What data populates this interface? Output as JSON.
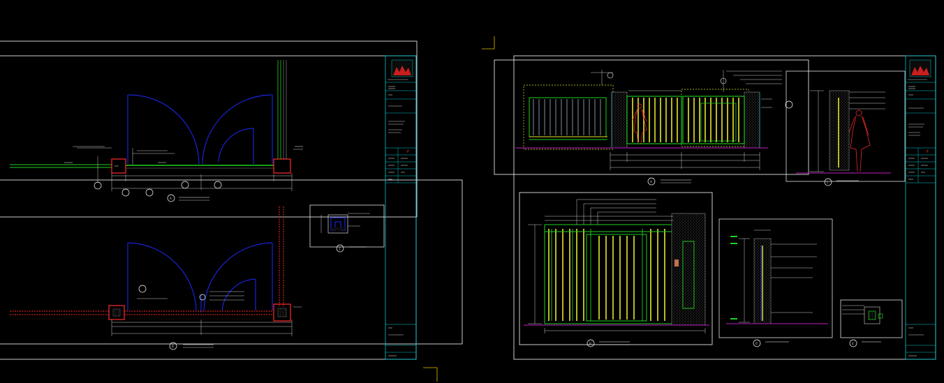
{
  "colors": {
    "background": "#000000",
    "sheet_border": "#ffffff",
    "title_block": "#00c8d0",
    "door_arc": "#1a2cff",
    "wall_green": "#1ed21e",
    "gate_yellow": "#e8e82a",
    "post_red": "#ff2a2a",
    "figure_red": "#ff3030",
    "floor_magenta": "#c020c0",
    "hatch_gray": "#9a9a9a",
    "logo_red": "#c81e1e",
    "corner_mark": "#e8c200"
  },
  "left_sheet": {
    "title_block": {
      "revision_mark": "F",
      "rows": [
        "",
        "",
        "",
        "",
        "",
        "",
        "",
        "",
        ""
      ]
    },
    "view_a": {
      "bubble": "A"
    },
    "view_b": {
      "bubble": "B"
    },
    "detail_1": {
      "bubble": "1"
    }
  },
  "right_sheet": {
    "title_block": {
      "revision_mark": "F",
      "rows": [
        "",
        "",
        "",
        "",
        "",
        "",
        "",
        "",
        ""
      ]
    },
    "elevation_a": {
      "bubble": "A"
    },
    "section_c": {
      "bubble": "C"
    },
    "elevation_b": {
      "bubble": "B"
    },
    "section_d": {
      "bubble": "D"
    },
    "detail_e": {
      "bubble": "E"
    }
  }
}
